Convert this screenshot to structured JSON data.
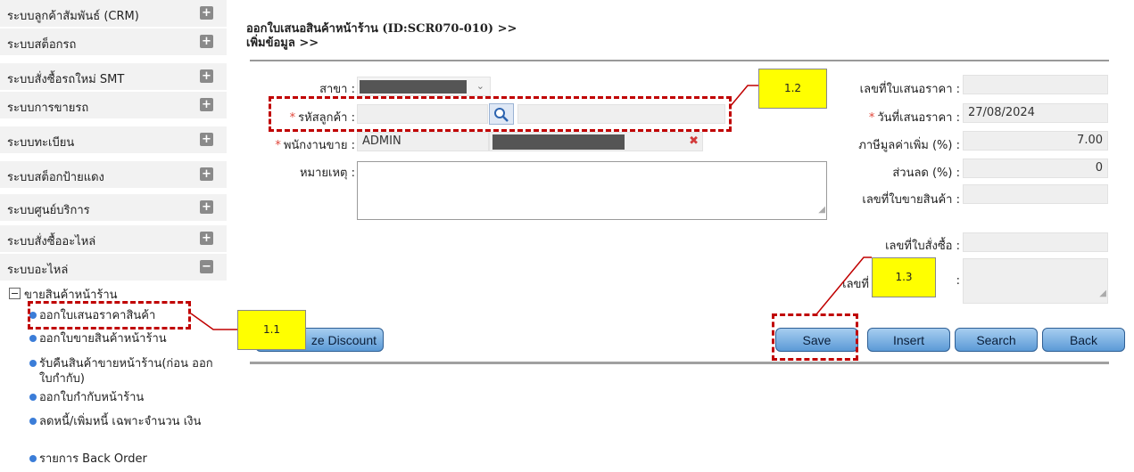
{
  "sidebar": {
    "menu": [
      {
        "label": "ระบบลูกค้าสัมพันธ์ (CRM)",
        "sign": "+"
      },
      {
        "label": "ระบบสต็อกรถ",
        "sign": "+"
      },
      {
        "label": "ระบบสั่งซื้อรถใหม่ SMT",
        "sign": "+"
      },
      {
        "label": "ระบบการขายรถ",
        "sign": "+"
      },
      {
        "label": "ระบบทะเบียน",
        "sign": "+"
      },
      {
        "label": "ระบบสต็อกป้ายแดง",
        "sign": "+"
      },
      {
        "label": "ระบบศูนย์บริการ",
        "sign": "+"
      },
      {
        "label": "ระบบสั่งซื้ออะไหล่",
        "sign": "+"
      },
      {
        "label": "ระบบอะไหล่",
        "sign": "−"
      }
    ],
    "submenu_title": "ขายสินค้าหน้าร้าน",
    "submenu": [
      "ออกใบเสนอราคาสินค้า",
      "ออกใบขายสินค้าหน้าร้าน",
      "รับคืนสินค้าขายหน้าร้าน(ก่อน ออกใบกำกับ)",
      "ออกใบกำกับหน้าร้าน",
      "ลดหนี้/เพิ่มหนี้ เฉพาะจำนวน เงิน",
      "รายการ Back Order"
    ]
  },
  "header": {
    "title_line1": "ออกใบเสนอสินค้าหน้าร้าน (ID:SCR070-010) >>",
    "title_line2": "เพิ่มข้อมูล >>"
  },
  "form": {
    "branch_label": "สาขา :",
    "customer_code_label": "รหัสลูกค้า :",
    "salesperson_label": "พนักงานขาย :",
    "salesperson_value": "ADMIN",
    "remark_label": "หมายเหตุ :",
    "quote_no_label": "เลขที่ใบเสนอราคา :",
    "quote_date_label": "วันที่เสนอราคา :",
    "quote_date_value": "27/08/2024",
    "vat_label": "ภาษีมูลค่าเพิ่ม (%) :",
    "vat_value": "7.00",
    "discount_label": "ส่วนลด (%) :",
    "discount_value": "0",
    "sale_no_label": "เลขที่ใบขายสินค้า :",
    "po_no_label": "เลขที่ใบสั่งซื้อ :",
    "last_label_prefix": "เลขที่",
    "last_label_suffix": ":",
    "required_mark": "*"
  },
  "buttons": {
    "discount": "ze Discount",
    "save": "Save",
    "insert": "Insert",
    "search": "Search",
    "back": "Back"
  },
  "callouts": {
    "c11": "1.1",
    "c12": "1.2",
    "c13": "1.3"
  },
  "colors": {
    "annotation_red": "#c00000",
    "callout_yellow": "#ffff00",
    "required_red": "#e0463a",
    "bullet_blue": "#3b7dd8"
  }
}
